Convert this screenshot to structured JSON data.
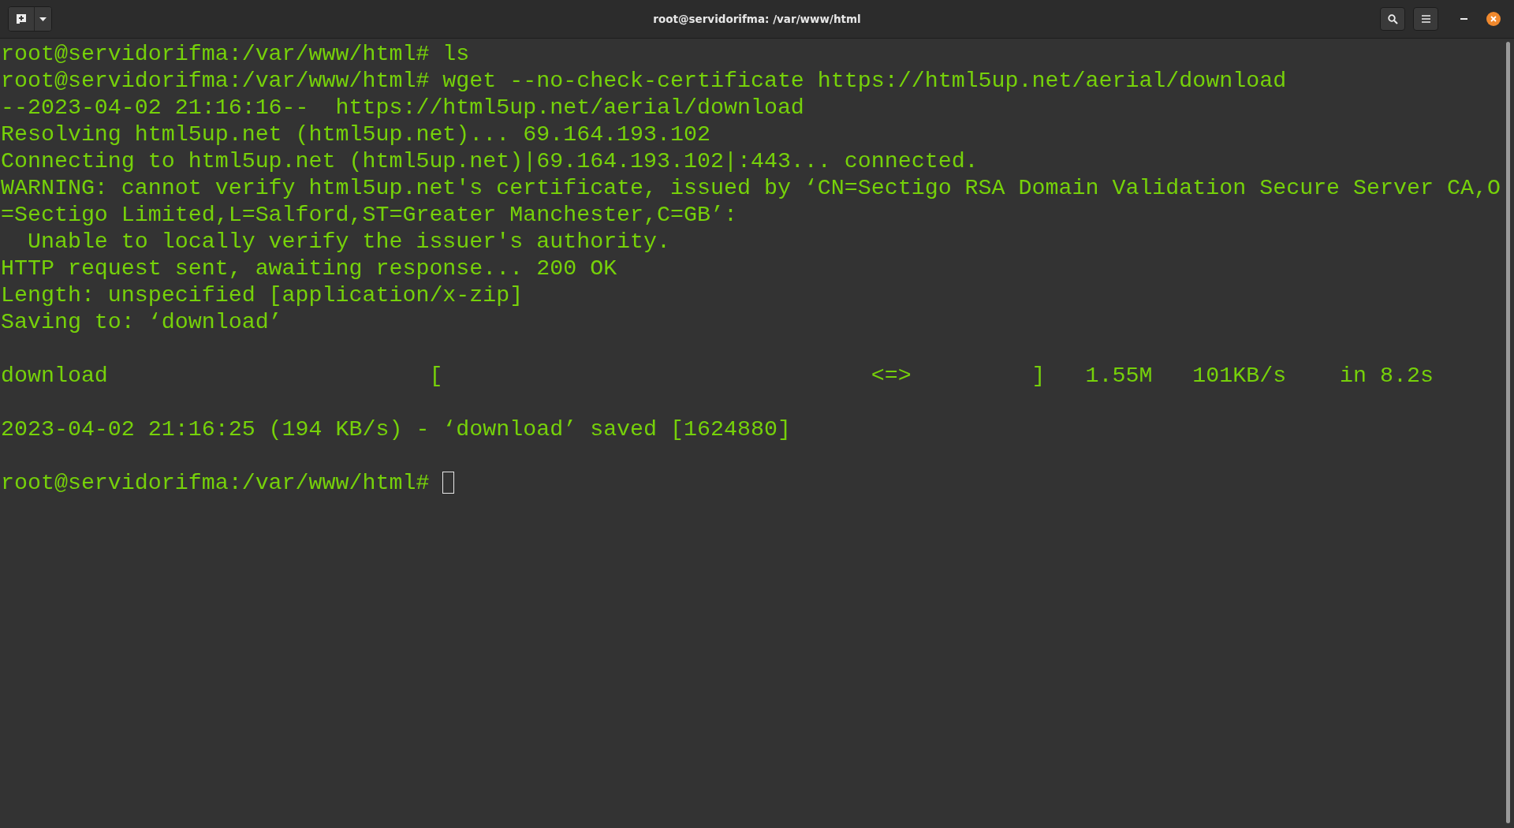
{
  "window": {
    "title": "root@servidorifma: /var/www/html"
  },
  "terminal": {
    "lines": [
      {
        "kind": "text",
        "text": "root@servidorifma:/var/www/html# ls"
      },
      {
        "kind": "text",
        "text": "root@servidorifma:/var/www/html# wget --no-check-certificate https://html5up.net/aerial/download"
      },
      {
        "kind": "text",
        "text": "--2023-04-02 21:16:16--  https://html5up.net/aerial/download"
      },
      {
        "kind": "text",
        "text": "Resolving html5up.net (html5up.net)... 69.164.193.102"
      },
      {
        "kind": "text",
        "text": "Connecting to html5up.net (html5up.net)|69.164.193.102|:443... connected."
      },
      {
        "kind": "text",
        "text": "WARNING: cannot verify html5up.net's certificate, issued by ‘CN=Sectigo RSA Domain Validation Secure Server CA,O"
      },
      {
        "kind": "text",
        "text": "=Sectigo Limited,L=Salford,ST=Greater Manchester,C=GB’:"
      },
      {
        "kind": "text",
        "text": "  Unable to locally verify the issuer's authority."
      },
      {
        "kind": "text",
        "text": "HTTP request sent, awaiting response... 200 OK"
      },
      {
        "kind": "text",
        "text": "Length: unspecified [application/x-zip]"
      },
      {
        "kind": "text",
        "text": "Saving to: ‘download’"
      },
      {
        "kind": "blank"
      },
      {
        "kind": "text",
        "text": "download                        [                                <=>         ]   1.55M   101KB/s    in 8.2s"
      },
      {
        "kind": "blank"
      },
      {
        "kind": "text",
        "text": "2023-04-02 21:16:25 (194 KB/s) - ‘download’ saved [1624880]"
      },
      {
        "kind": "blank"
      },
      {
        "kind": "prompt",
        "text": "root@servidorifma:/var/www/html# "
      }
    ]
  }
}
